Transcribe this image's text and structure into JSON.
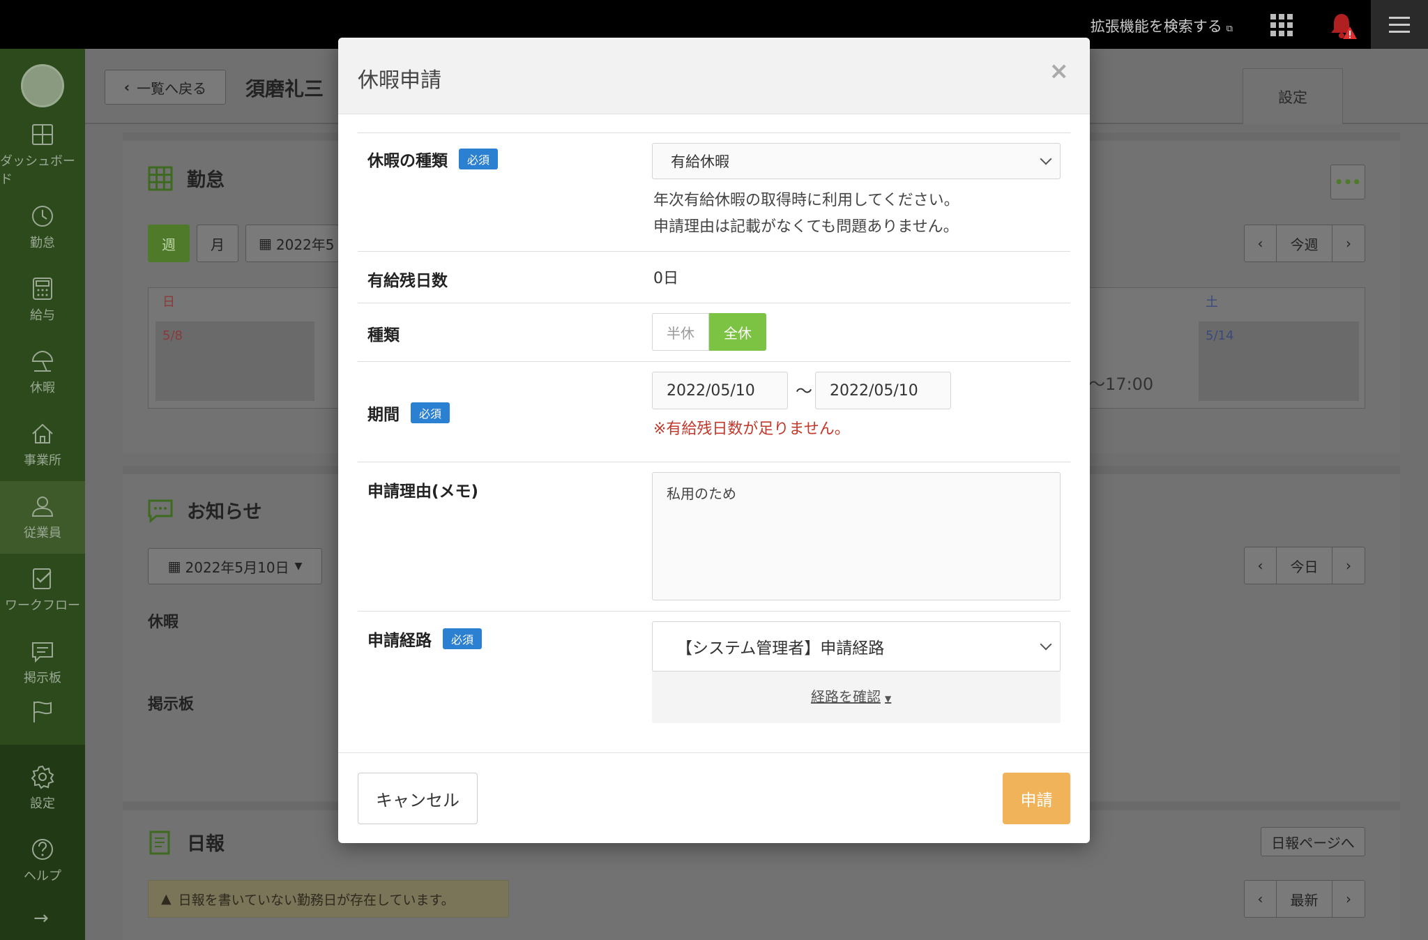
{
  "topbar": {
    "search_extensions": "拡張機能を検索する",
    "ext_icon": "external-link-icon",
    "alert_color": "#e03030"
  },
  "sidebar": {
    "items": [
      {
        "label": "ダッシュボード",
        "icon": "dashboard-icon"
      },
      {
        "label": "勤怠",
        "icon": "clock-icon"
      },
      {
        "label": "給与",
        "icon": "calculator-icon"
      },
      {
        "label": "休暇",
        "icon": "umbrella-icon"
      },
      {
        "label": "事業所",
        "icon": "home-icon"
      },
      {
        "label": "従業員",
        "icon": "person-icon"
      },
      {
        "label": "ワークフロー",
        "icon": "checklist-icon"
      },
      {
        "label": "掲示板",
        "icon": "chat-icon"
      },
      {
        "label": "",
        "icon": "flag-icon"
      },
      {
        "label": "設定",
        "icon": "gear-icon"
      },
      {
        "label": "ヘルプ",
        "icon": "help-icon"
      }
    ],
    "expand_arrow": "→"
  },
  "background": {
    "back_button": "一覧へ戻る",
    "employee_name": "須磨礼三",
    "settings_tab": "設定",
    "attendance": {
      "title": "勤怠",
      "week": "週",
      "month": "月",
      "date_partial": "2022年5",
      "prev": "‹",
      "this_week": "今週",
      "next": "›",
      "day_sun": "日",
      "day_sat": "土",
      "date_sun": "5/8",
      "date_sat": "5/14",
      "time_text": "～17:00"
    },
    "notice": {
      "title": "お知らせ",
      "date": "2022年5月10日",
      "today": "今日",
      "leave_label": "休暇",
      "board_label": "掲示板"
    },
    "daily": {
      "title": "日報",
      "page_link": "日報ページへ",
      "latest": "最新",
      "warning": "日報を書いていない勤務日が存在しています。"
    }
  },
  "modal": {
    "title": "休暇申請",
    "close": "×",
    "required_badge": "必須",
    "leave_type": {
      "label": "休暇の種類",
      "selected": "有給休暇",
      "help_line1": "年次有給休暇の取得時に利用してください。",
      "help_line2": "申請理由は記載がなくても問題ありません。"
    },
    "remaining": {
      "label": "有給残日数",
      "value": "0日"
    },
    "kind": {
      "label": "種類",
      "half": "半休",
      "full": "全休",
      "selected": "全休"
    },
    "period": {
      "label": "期間",
      "start": "2022/05/10",
      "separator": "〜",
      "end": "2022/05/10",
      "error": "※有給残日数が足りません。"
    },
    "memo": {
      "label": "申請理由(メモ)",
      "value": "私用のため"
    },
    "route": {
      "label": "申請経路",
      "selected": "【システム管理者】申請経路",
      "confirm_link": "経路を確認"
    },
    "footer": {
      "cancel": "キャンセル",
      "submit": "申請"
    }
  }
}
